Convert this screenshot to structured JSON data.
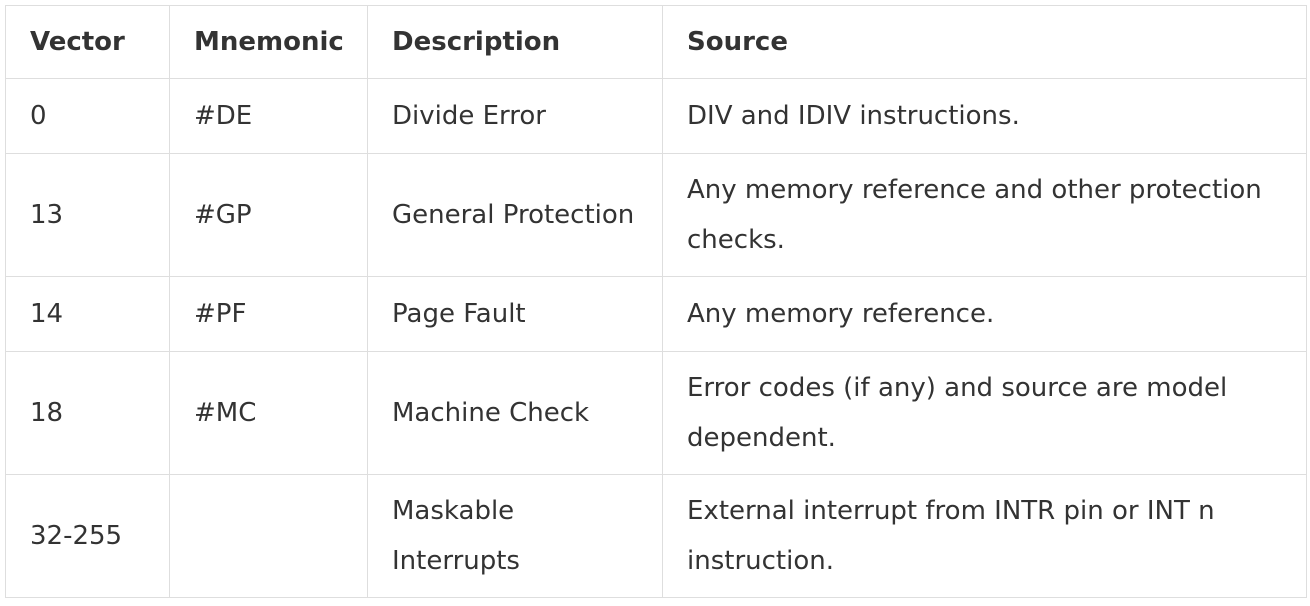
{
  "table": {
    "headers": [
      "Vector",
      "Mnemonic",
      "Description",
      "Source"
    ],
    "rows": [
      {
        "vector": "0",
        "mnemonic": "#DE",
        "description": "Divide Error",
        "source": "DIV and IDIV instructions."
      },
      {
        "vector": "13",
        "mnemonic": "#GP",
        "description": "General Protection",
        "source": "Any memory reference and other protection checks."
      },
      {
        "vector": "14",
        "mnemonic": "#PF",
        "description": "Page Fault",
        "source": "Any memory reference."
      },
      {
        "vector": "18",
        "mnemonic": "#MC",
        "description": "Machine Check",
        "source": "Error codes (if any) and source are model dependent."
      },
      {
        "vector": "32-255",
        "mnemonic": "",
        "description": "Maskable Interrupts",
        "source": "External interrupt from INTR pin or INT n instruction."
      }
    ]
  }
}
